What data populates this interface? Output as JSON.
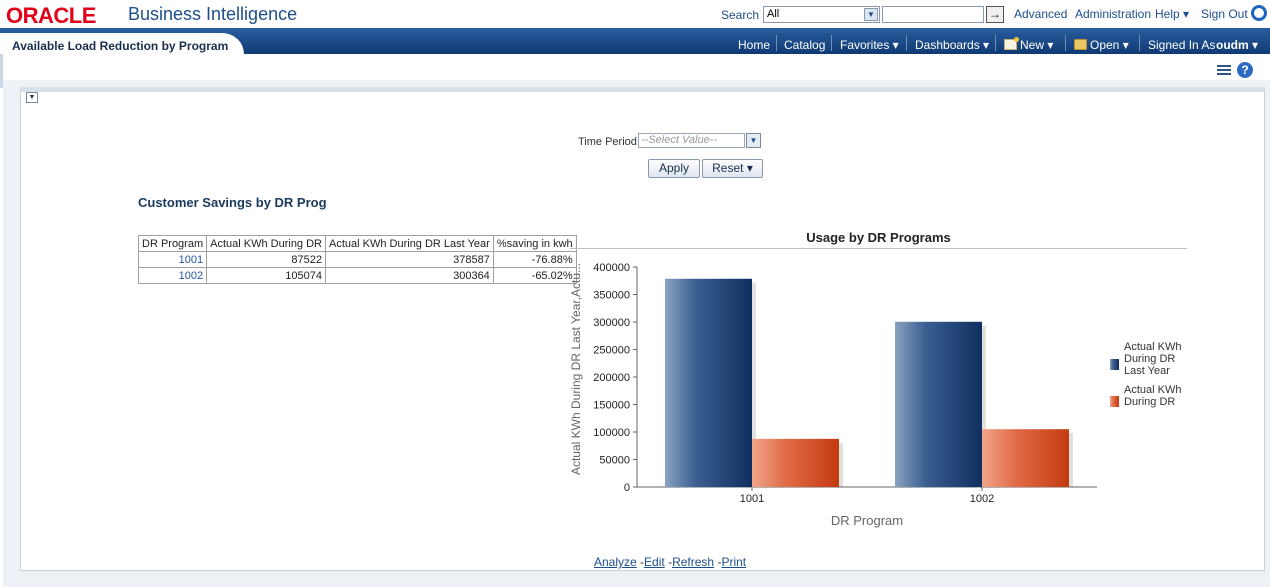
{
  "header": {
    "logo": "ORACLE",
    "product": "Business Intelligence",
    "search_label": "Search",
    "search_scope": "All",
    "search_go": "→",
    "links": [
      "Advanced",
      "Administration",
      "Help ▾",
      "Sign Out"
    ]
  },
  "nav": {
    "page_title": "Available Load Reduction by Program",
    "items": [
      "Home",
      "Catalog",
      "Favorites ▾",
      "Dashboards ▾",
      "New ▾",
      "Open ▾"
    ],
    "signed_in_label": "Signed In As",
    "user": "oudm ▾"
  },
  "prompt": {
    "label": "Time Period",
    "placeholder": "--Select Value--",
    "apply": "Apply",
    "reset": "Reset ▾"
  },
  "report": {
    "title": "Customer Savings by DR Prog",
    "columns": [
      "DR Program",
      "Actual KWh During DR",
      "Actual KWh During DR Last Year",
      "%saving in kwh"
    ],
    "rows": [
      [
        "1001",
        "87522",
        "378587",
        "-76.88%"
      ],
      [
        "1002",
        "105074",
        "300364",
        "-65.02%"
      ]
    ]
  },
  "chart_data": {
    "type": "bar",
    "title": "Usage by DR Programs",
    "xlabel": "DR Program",
    "ylabel": "Actual KWh During DR Last Year,Actu...",
    "categories": [
      "1001",
      "1002"
    ],
    "series": [
      {
        "name": "Actual KWh During DR Last Year",
        "values": [
          378587,
          300364
        ],
        "color": "#1c3f73"
      },
      {
        "name": "Actual KWh During DR",
        "values": [
          87522,
          105074
        ],
        "color": "#d4441c"
      }
    ],
    "ylim": [
      0,
      400000
    ],
    "yticks": [
      "0",
      "50000",
      "100000",
      "150000",
      "200000",
      "250000",
      "300000",
      "350000",
      "400000"
    ],
    "legend_position": "right"
  },
  "footer": {
    "analyze": "Analyze",
    "edit": "Edit",
    "refresh": "Refresh",
    "print": "Print"
  }
}
